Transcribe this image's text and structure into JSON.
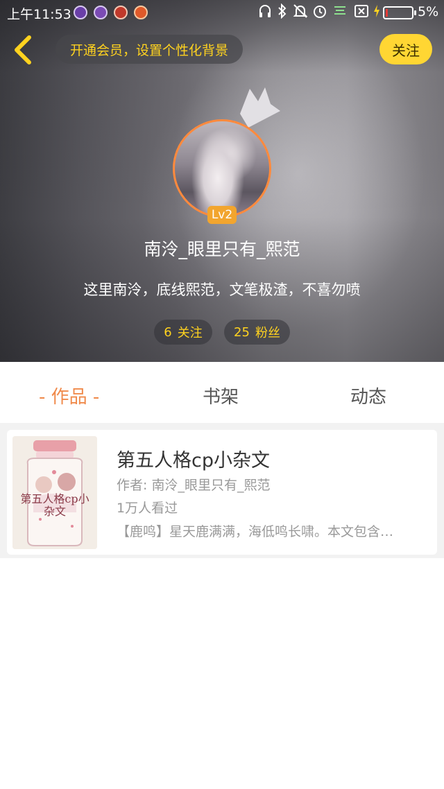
{
  "status_bar": {
    "time": "上午11:53",
    "battery_percent": "5%",
    "battery_level": 0.05
  },
  "header": {
    "vip_banner": "开通会员，设置个性化背景",
    "follow_label": "关注"
  },
  "profile": {
    "level": "Lv2",
    "username": "南泠_眼里只有_熙范",
    "bio": "这里南泠，底线熙范，文笔极渣，不喜勿喷",
    "following_count": "6",
    "following_label": "关注",
    "fans_count": "25",
    "fans_label": "粉丝"
  },
  "tabs": [
    {
      "label": "- 作品 -",
      "active": true
    },
    {
      "label": "书架",
      "active": false
    },
    {
      "label": "动态",
      "active": false
    }
  ],
  "works": [
    {
      "title": "第五人格cp小杂文",
      "author": "作者: 南泠_眼里只有_熙范",
      "views": "1万人看过",
      "description": "【鹿鸣】星天鹿满满，海低鸣长啸。本文包含…",
      "cover_text": "第五人格cp小杂文"
    }
  ],
  "colors": {
    "accent_orange": "#f08a4b",
    "follow_yellow": "#ffd633",
    "vip_text": "#ffd21f",
    "avatar_ring": "#ff8a3d",
    "level_badge": "#f2a52e"
  }
}
